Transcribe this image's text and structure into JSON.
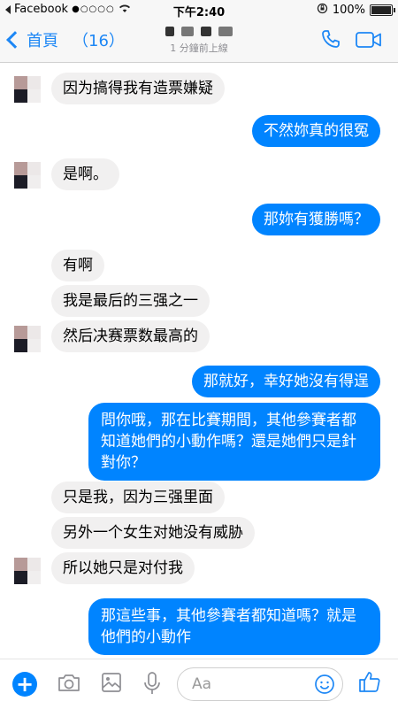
{
  "status_bar": {
    "carrier": "Facebook",
    "signal_dots": "●○○○○",
    "time": "下午2:40",
    "battery": "100%"
  },
  "nav": {
    "back_label": "首頁",
    "unread_count": "（16）",
    "active_status": "1 分鐘前上線"
  },
  "messages": [
    {
      "side": "in",
      "text": "因为搞得我有造票嫌疑"
    },
    {
      "side": "out",
      "text": "不然妳真的很冤"
    },
    {
      "side": "in",
      "text": "是啊。"
    },
    {
      "side": "out",
      "text": "那妳有獲勝嗎？"
    },
    {
      "side": "in",
      "text": "有啊"
    },
    {
      "side": "in",
      "text": "我是最后的三强之一"
    },
    {
      "side": "in",
      "text": "然后决赛票数最高的"
    },
    {
      "side": "out",
      "text": "那就好，幸好她沒有得逞"
    },
    {
      "side": "out",
      "text": "問你哦，那在比賽期間，其他參賽者都知道她們的小動作嗎？還是她們只是針對你？"
    },
    {
      "side": "in",
      "text": "只是我，因为三强里面"
    },
    {
      "side": "in",
      "text": "另外一个女生对她没有威胁"
    },
    {
      "side": "in",
      "text": "所以她只是对付我"
    },
    {
      "side": "out",
      "text": "那這些事，其他參賽者都知道嗎？就是他們的小動作"
    }
  ],
  "composer": {
    "placeholder": "Aa"
  },
  "colors": {
    "accent": "#0084ff",
    "incoming_bubble": "#f1f0f0",
    "nav_icon": "#1d87f5"
  }
}
